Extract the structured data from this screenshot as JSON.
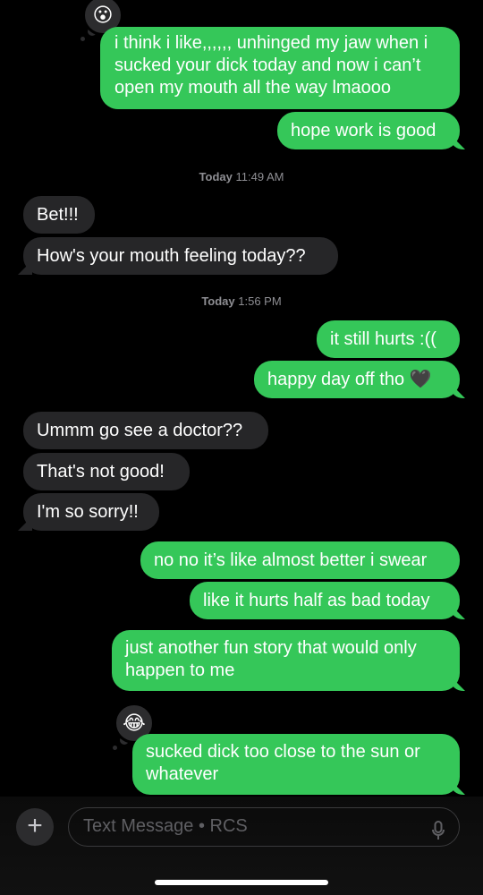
{
  "messages": {
    "m1": {
      "text_l1": "i think i like,,,,,, unhinged my jaw when i",
      "text_l2": "sucked your dick today and now i can’t",
      "text_l3": "open my mouth all the way lmaooo",
      "reaction": "😮"
    },
    "m2": "hope work is good",
    "ts1": {
      "day": "Today",
      "time": "11:49 AM"
    },
    "m3": "Bet!!!",
    "m4": "How's your mouth feeling today??",
    "ts2": {
      "day": "Today",
      "time": "1:56 PM"
    },
    "m5": "it still hurts :((",
    "m6": "happy day off tho 🖤",
    "m7": "Ummm go see a doctor??",
    "m8": "That's not good!",
    "m9": "I'm so sorry!!",
    "m10": "no no it’s like almost better i swear",
    "m11": "like it hurts half as bad today",
    "m12": {
      "text_l1": "just another fun story that would only",
      "text_l2": "happen to me"
    },
    "m13": {
      "text_l1": "sucked dick too close to the sun or",
      "text_l2": "whatever",
      "reaction": "😂"
    }
  },
  "composer": {
    "plus": "+",
    "placeholder": "Text Message • RCS",
    "mic_icon": "microphone-icon"
  },
  "colors": {
    "sent": "#35c759",
    "received": "#262628",
    "background": "#000000"
  }
}
